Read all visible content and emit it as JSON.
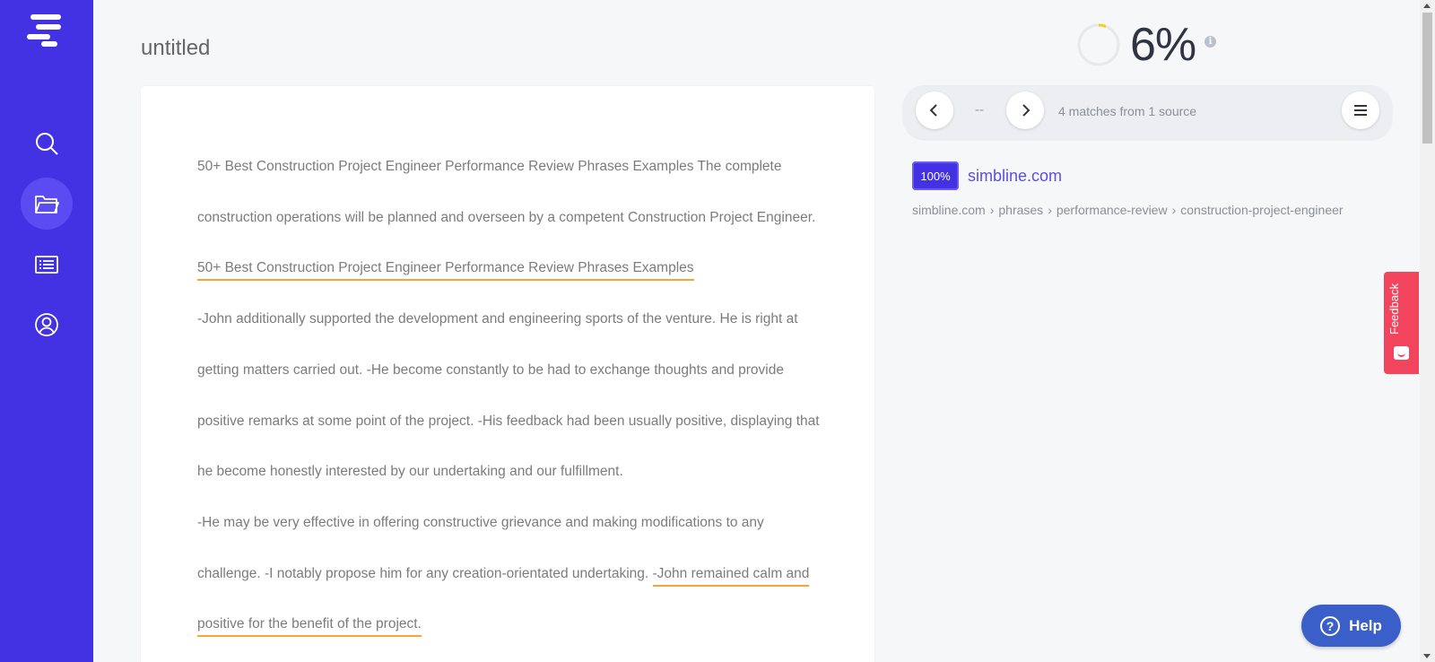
{
  "sidebar": {
    "items": [
      {
        "name": "search",
        "icon": "search-icon"
      },
      {
        "name": "documents",
        "icon": "folder-icon",
        "active": true
      },
      {
        "name": "list",
        "icon": "list-icon"
      },
      {
        "name": "account",
        "icon": "user-icon"
      }
    ],
    "accent": "#4232e4"
  },
  "document": {
    "title": "untitled",
    "paragraphs": [
      {
        "segments": [
          {
            "text": "50+ Best Construction Project Engineer Performance Review Phrases Examples The complete construction operations will be planned and overseen by a competent Construction Project Engineer. ",
            "match": false
          },
          {
            "text": "50+ Best Construction Project Engineer Performance Review Phrases Examples",
            "match": true
          }
        ]
      },
      {
        "segments": [
          {
            "text": "-John additionally supported the development and engineering sports of the venture. He is right at getting matters carried out. -He become constantly to be had to exchange thoughts and provide positive remarks at some point of the project. -His feedback had been usually positive, displaying that he become honestly interested by our undertaking and our fulfillment.",
            "match": false
          }
        ]
      },
      {
        "segments": [
          {
            "text": "-He may be very effective in offering constructive grievance and making modifications to any challenge. -I notably propose him for any creation-orientated undertaking. ",
            "match": false
          },
          {
            "text": "-John remained calm and positive for the benefit of the project.",
            "match": true
          }
        ]
      }
    ]
  },
  "score": {
    "value": "6%",
    "fraction": 0.06,
    "ring_color": "#f5d020",
    "info_icon": "info-icon"
  },
  "matches": {
    "index": "--",
    "summary": "4 matches from 1 source",
    "prev_icon": "chevron-left-icon",
    "next_icon": "chevron-right-icon",
    "menu_icon": "menu-icon"
  },
  "source": {
    "badge": "100%",
    "name": "simbline.com",
    "path": [
      "simbline.com",
      "phrases",
      "performance-review",
      "construction-project-engineer"
    ],
    "separator": "›"
  },
  "feedback": {
    "label": "Feedback"
  },
  "help": {
    "label": "Help",
    "icon": "?"
  },
  "colors": {
    "match_underline": "#f5a63b",
    "feedback": "#f2445d",
    "help": "#3b5fc9"
  }
}
